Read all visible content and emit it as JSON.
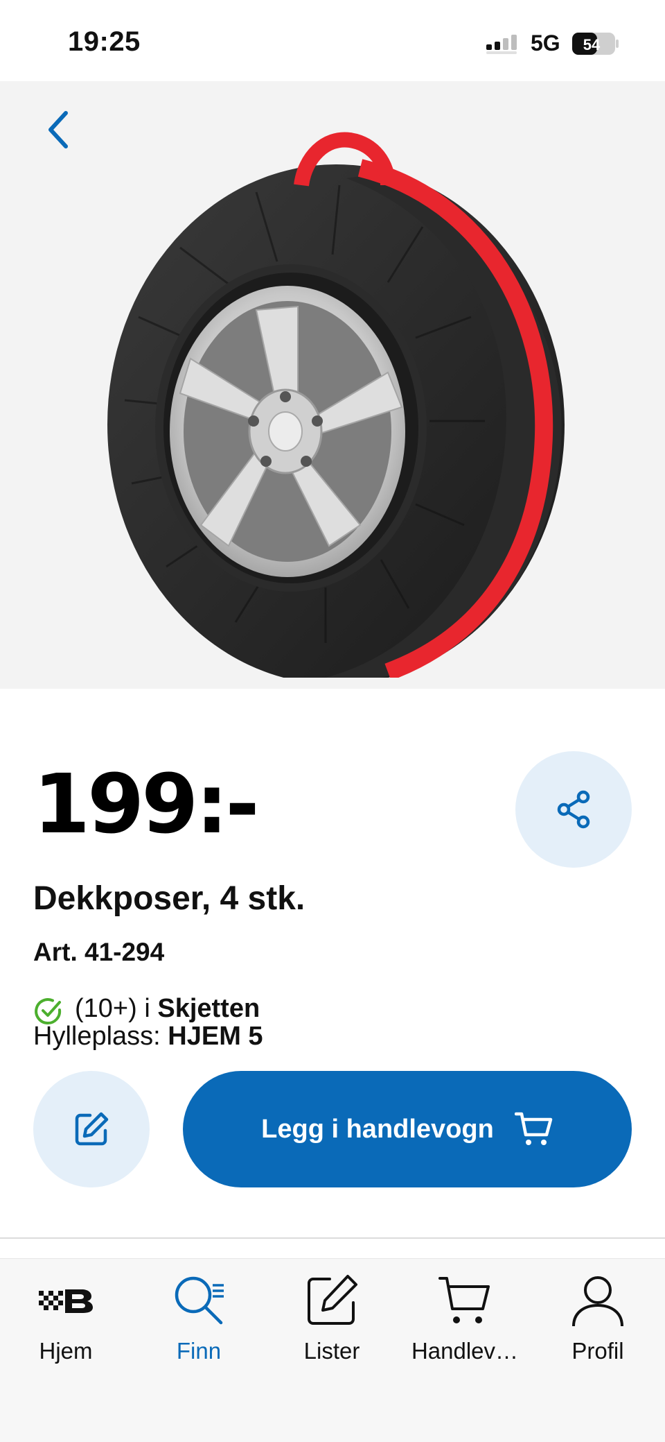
{
  "status_bar": {
    "time": "19:25",
    "network": "5G",
    "battery": "54"
  },
  "product": {
    "price": "199:-",
    "title": "Dekkposer, 4 stk.",
    "article": "Art. 41-294",
    "stock_count": "(10+) i",
    "store": "Skjetten",
    "shelf_label": "Hylleplass:",
    "shelf_value": "HJEM 5"
  },
  "actions": {
    "add_to_cart": "Legg i handlevogn"
  },
  "bottom_nav": {
    "items": [
      {
        "label": "Hjem",
        "icon": "home-logo-icon"
      },
      {
        "label": "Finn",
        "icon": "search-list-icon",
        "active": true
      },
      {
        "label": "Lister",
        "icon": "edit-list-icon"
      },
      {
        "label": "Handlev…",
        "icon": "cart-icon"
      },
      {
        "label": "Profil",
        "icon": "profile-icon"
      }
    ]
  },
  "colors": {
    "accent": "#0a6ab8",
    "accent_light": "#e4eff9",
    "stock_green": "#4caf2e",
    "strap_red": "#e8262e"
  }
}
